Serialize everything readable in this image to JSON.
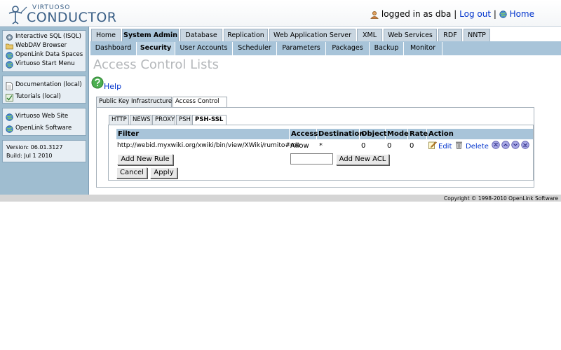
{
  "header": {
    "logo_small": "VIRTUOSO",
    "logo_big": "CONDUCTOR",
    "logged_in_text": "logged in as dba",
    "separator1": "|",
    "logout_label": "Log out",
    "separator2": "|",
    "home_label": "Home"
  },
  "sidebar": {
    "group1": [
      {
        "label": "Interactive SQL (ISQL)",
        "icon": "gear-icon"
      },
      {
        "label": "WebDAV Browser",
        "icon": "folder-icon"
      },
      {
        "label": "OpenLink Data Spaces",
        "icon": "globe-icon"
      },
      {
        "label": "Virtuoso Start Menu",
        "icon": "globe-icon"
      }
    ],
    "group2": [
      {
        "label": "Documentation (local)",
        "icon": "document-icon"
      },
      {
        "label": "Tutorials (local)",
        "icon": "tutorial-icon"
      }
    ],
    "group3": [
      {
        "label": "Virtuoso Web Site",
        "icon": "globe-icon"
      },
      {
        "label": "OpenLink Software",
        "icon": "globe-icon"
      }
    ],
    "version": "Version: 06.01.3127",
    "build": "Build: Jul 1 2010"
  },
  "main_tabs": [
    "Home",
    "System Admin",
    "Database",
    "Replication",
    "Web Application Server",
    "XML",
    "Web Services",
    "RDF",
    "NNTP"
  ],
  "main_tab_active": "System Admin",
  "sub_tabs": [
    "Dashboard",
    "Security",
    "User Accounts",
    "Scheduler",
    "Parameters",
    "Packages",
    "Backup",
    "Monitor"
  ],
  "sub_tab_active": "Security",
  "page_title": "Access Control Lists",
  "help_label": "Help",
  "section_tabs": [
    "Public Key Infrastructure",
    "Access Control"
  ],
  "protocol_tabs": [
    "HTTP",
    "NEWS",
    "PROXY",
    "PSH",
    "PSH-SSL"
  ],
  "acl_table": {
    "headers": [
      "Filter",
      "Access",
      "Destination",
      "Object",
      "Mode",
      "Rate",
      "Action"
    ],
    "rows": [
      {
        "filter": "http://webid.myxwiki.org/xwiki/bin/view/XWiki/rumito#me",
        "access": "Allow",
        "destination": "*",
        "object": "0",
        "mode": "0",
        "rate": "0",
        "edit_label": "Edit",
        "delete_label": "Delete"
      }
    ]
  },
  "buttons": {
    "add_rule": "Add New Rule",
    "add_acl": "Add New ACL",
    "cancel": "Cancel",
    "apply": "Apply"
  },
  "acl_name_value": "",
  "copyright": "Copyright © 1998-2010 OpenLink Software",
  "colors": {
    "tab_active": "#a8c4d9",
    "sidebar": "#9fbdd0",
    "link": "#0033cc"
  }
}
